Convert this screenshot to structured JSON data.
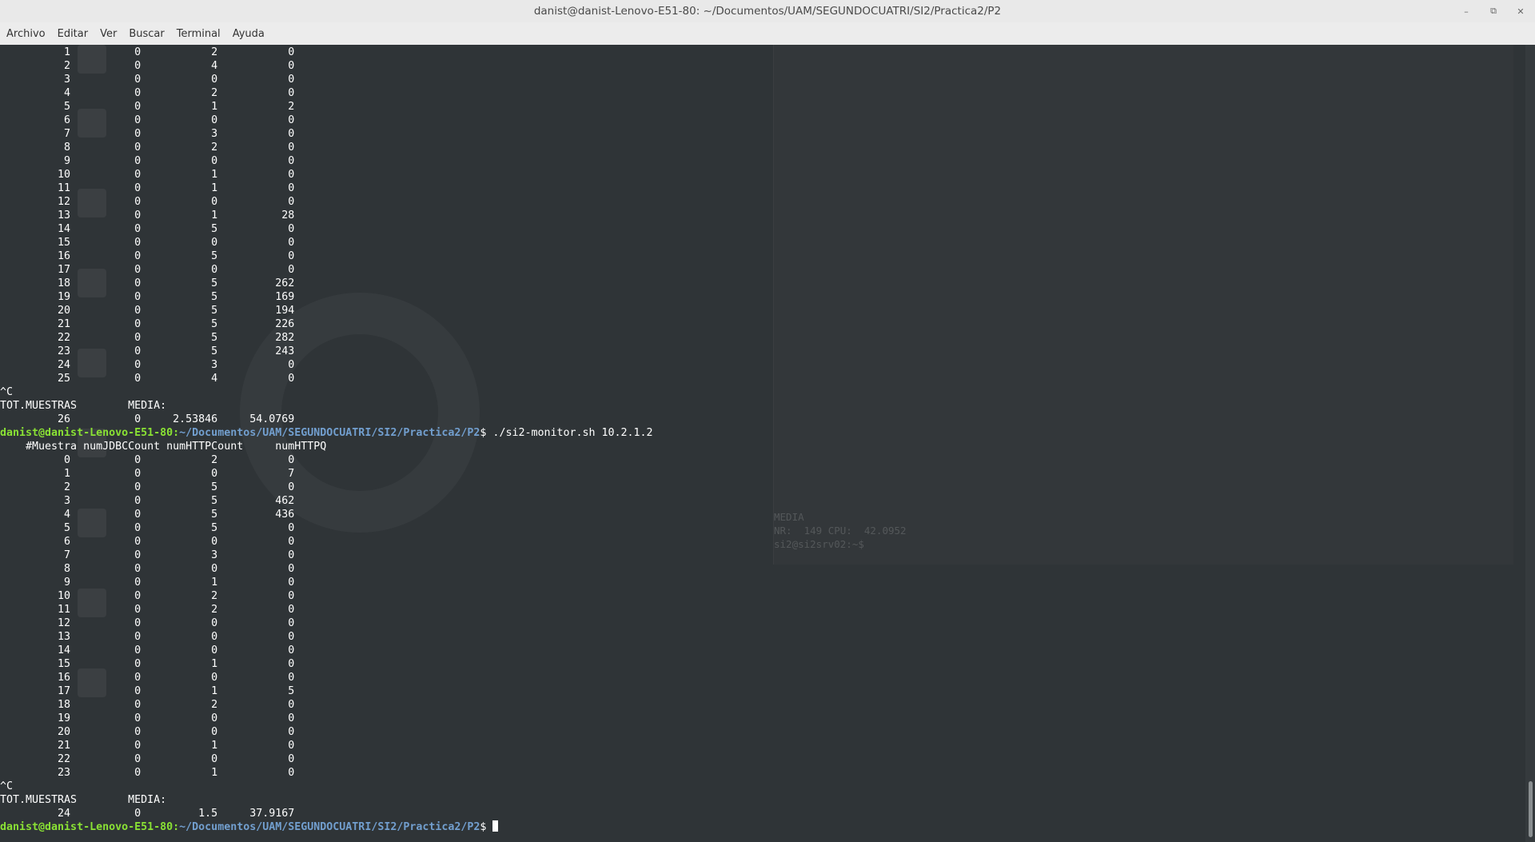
{
  "window": {
    "title": "danist@danist-Lenovo-E51-80: ~/Documentos/UAM/SEGUNDOCUATRI/SI2/Practica2/P2"
  },
  "menu": [
    "Archivo",
    "Editar",
    "Ver",
    "Buscar",
    "Terminal",
    "Ayuda"
  ],
  "prompt": {
    "user": "danist@danist-Lenovo-E51-80",
    "path": "~/Documentos/UAM/SEGUNDOCUATRI/SI2/Practica2/P2",
    "symbol": "$"
  },
  "terminal": {
    "run1_rows": [
      [
        "1",
        "0",
        "2",
        "0"
      ],
      [
        "2",
        "0",
        "4",
        "0"
      ],
      [
        "3",
        "0",
        "0",
        "0"
      ],
      [
        "4",
        "0",
        "2",
        "0"
      ],
      [
        "5",
        "0",
        "1",
        "2"
      ],
      [
        "6",
        "0",
        "0",
        "0"
      ],
      [
        "7",
        "0",
        "3",
        "0"
      ],
      [
        "8",
        "0",
        "2",
        "0"
      ],
      [
        "9",
        "0",
        "0",
        "0"
      ],
      [
        "10",
        "0",
        "1",
        "0"
      ],
      [
        "11",
        "0",
        "1",
        "0"
      ],
      [
        "12",
        "0",
        "0",
        "0"
      ],
      [
        "13",
        "0",
        "1",
        "28"
      ],
      [
        "14",
        "0",
        "5",
        "0"
      ],
      [
        "15",
        "0",
        "0",
        "0"
      ],
      [
        "16",
        "0",
        "5",
        "0"
      ],
      [
        "17",
        "0",
        "0",
        "0"
      ],
      [
        "18",
        "0",
        "5",
        "262"
      ],
      [
        "19",
        "0",
        "5",
        "169"
      ],
      [
        "20",
        "0",
        "5",
        "194"
      ],
      [
        "21",
        "0",
        "5",
        "226"
      ],
      [
        "22",
        "0",
        "5",
        "282"
      ],
      [
        "23",
        "0",
        "5",
        "243"
      ],
      [
        "24",
        "0",
        "3",
        "0"
      ],
      [
        "25",
        "0",
        "4",
        "0"
      ]
    ],
    "interrupt": "^C",
    "tot_label": "TOT.MUESTRAS",
    "media_label": "MEDIA:",
    "run1_totals": [
      "26",
      "0",
      "2.53846",
      "54.0769"
    ],
    "command": "./si2-monitor.sh 10.2.1.2",
    "headers": [
      "#Muestra",
      "numJDBCCount",
      "numHTTPCount",
      "numHTTPQ"
    ],
    "run2_rows": [
      [
        "0",
        "0",
        "2",
        "0"
      ],
      [
        "1",
        "0",
        "0",
        "7"
      ],
      [
        "2",
        "0",
        "5",
        "0"
      ],
      [
        "3",
        "0",
        "5",
        "462"
      ],
      [
        "4",
        "0",
        "5",
        "436"
      ],
      [
        "5",
        "0",
        "5",
        "0"
      ],
      [
        "6",
        "0",
        "0",
        "0"
      ],
      [
        "7",
        "0",
        "3",
        "0"
      ],
      [
        "8",
        "0",
        "0",
        "0"
      ],
      [
        "9",
        "0",
        "1",
        "0"
      ],
      [
        "10",
        "0",
        "2",
        "0"
      ],
      [
        "11",
        "0",
        "2",
        "0"
      ],
      [
        "12",
        "0",
        "0",
        "0"
      ],
      [
        "13",
        "0",
        "0",
        "0"
      ],
      [
        "14",
        "0",
        "0",
        "0"
      ],
      [
        "15",
        "0",
        "1",
        "0"
      ],
      [
        "16",
        "0",
        "0",
        "0"
      ],
      [
        "17",
        "0",
        "1",
        "5"
      ],
      [
        "18",
        "0",
        "2",
        "0"
      ],
      [
        "19",
        "0",
        "0",
        "0"
      ],
      [
        "20",
        "0",
        "0",
        "0"
      ],
      [
        "21",
        "0",
        "1",
        "0"
      ],
      [
        "22",
        "0",
        "0",
        "0"
      ],
      [
        "23",
        "0",
        "1",
        "0"
      ]
    ],
    "run2_totals": [
      "24",
      "0",
      "1.5",
      "37.9167"
    ]
  },
  "background_terminal": {
    "foot_lines": [
      "MEDIA",
      "NR:  149 CPU:  42.0952",
      "",
      "si2@si2srv02:~$ "
    ]
  },
  "colors": {
    "titlebar_bg": "#e9e9e9",
    "terminal_bg": "#2f3437",
    "prompt_user": "#8ae234",
    "prompt_path": "#729fcf",
    "text": "#ffffff"
  }
}
